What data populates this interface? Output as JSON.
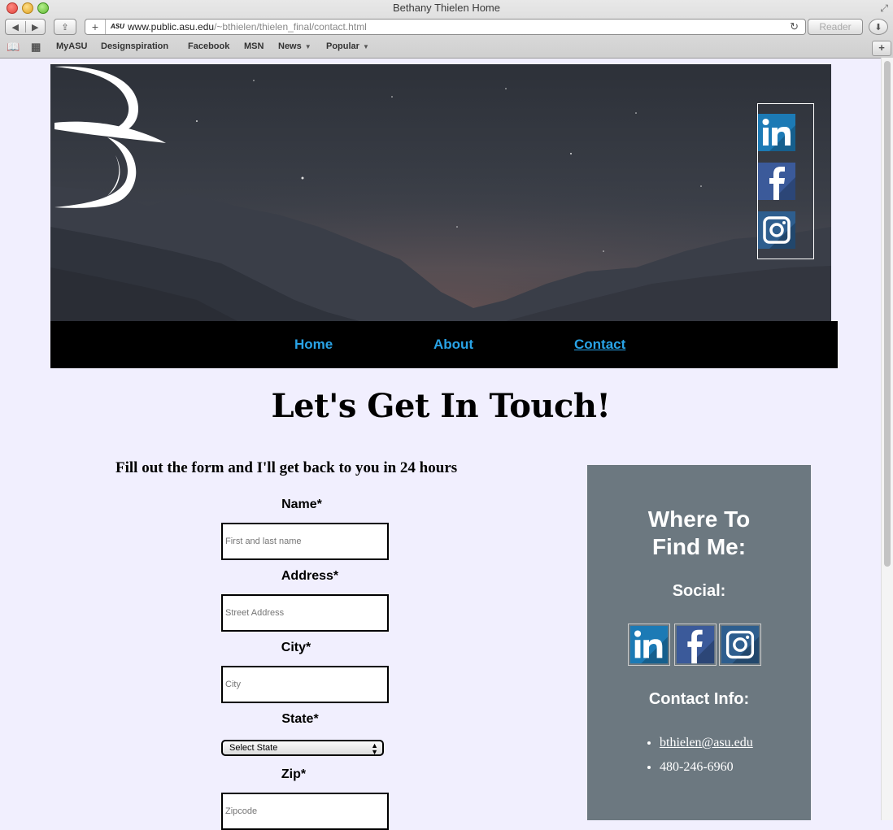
{
  "browser": {
    "window_title": "Bethany Thielen Home",
    "url_host": "www.public.asu.edu",
    "url_path": "/~bthielen/thielen_final/contact.html",
    "url_favicon": "ASU",
    "reader_label": "Reader",
    "bookmarks": [
      "MyASU",
      "Designspiration",
      "Facebook",
      "MSN",
      "News",
      "Popular"
    ]
  },
  "nav": {
    "items": [
      {
        "label": "Home"
      },
      {
        "label": "About"
      },
      {
        "label": "Contact"
      }
    ],
    "active": "Contact",
    "link_color": "#29a3e6"
  },
  "page": {
    "title": "Let's Get In Touch!",
    "form_intro": "Fill out the form and I'll get back to you in 24 hours"
  },
  "form": {
    "name_label": "Name*",
    "name_placeholder": "First and last name",
    "address_label": "Address*",
    "address_placeholder": "Street Address",
    "city_label": "City*",
    "city_placeholder": "City",
    "state_label": "State*",
    "state_selected": "Select State",
    "zip_label": "Zip*",
    "zip_placeholder": "Zipcode"
  },
  "sidebar": {
    "title_line1": "Where To",
    "title_line2": "Find Me:",
    "social_heading": "Social:",
    "contact_heading": "Contact Info:",
    "email": "bthielen@asu.edu",
    "phone": "480-246-6960",
    "background": "#6c7880"
  },
  "icons": {
    "linkedin": {
      "name": "linkedin-icon",
      "color": "#1c7ab5"
    },
    "facebook": {
      "name": "facebook-icon",
      "color": "#3b5a9a"
    },
    "instagram": {
      "name": "instagram-icon",
      "color": "#2e5e8e"
    }
  }
}
